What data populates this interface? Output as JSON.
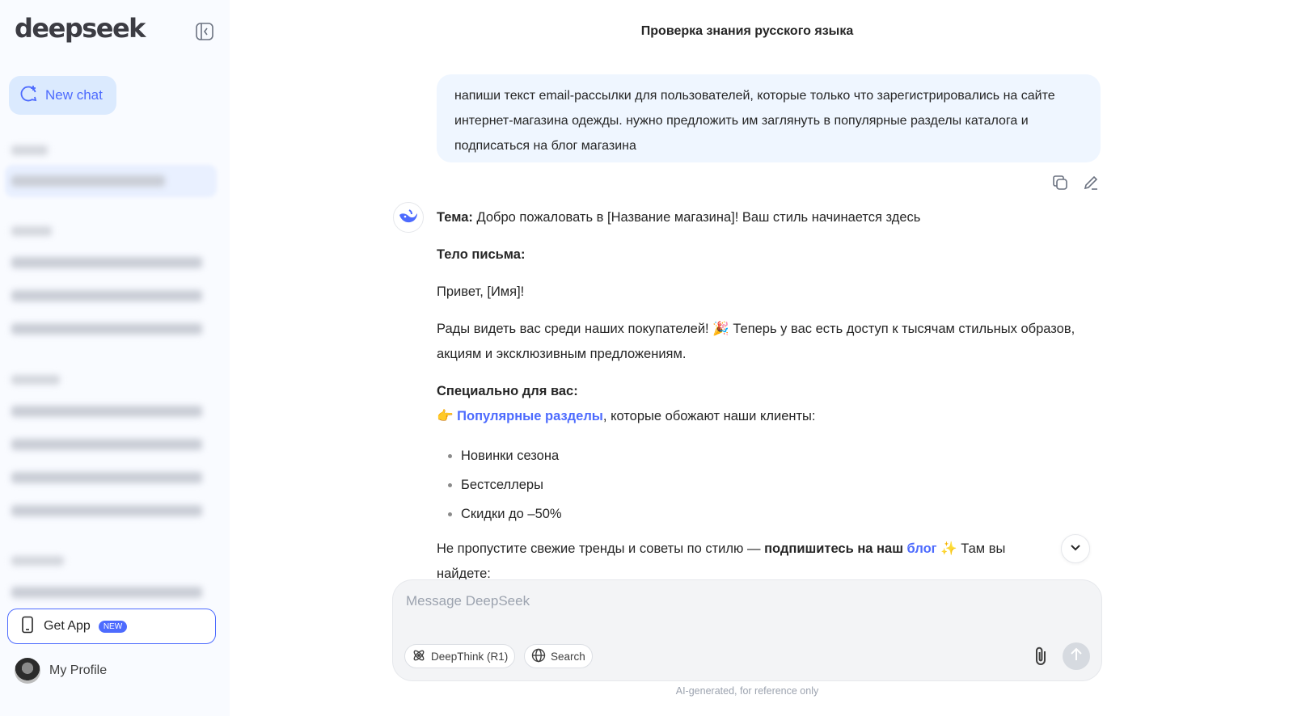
{
  "app": {
    "logo": "deepseek"
  },
  "sidebar": {
    "new_chat_label": "New chat",
    "get_app_label": "Get App",
    "get_app_badge": "NEW",
    "profile_label": "My Profile"
  },
  "chat": {
    "title": "Проверка знания русского языка",
    "user_message": "напиши текст email-рассылки для пользователей, которые только что зарегистрировались на сайте интернет-магазина одежды. нужно предложить им заглянуть в популярные разделы каталога и подписаться на блог магазина",
    "answer": {
      "topic_label": "Тема:",
      "topic_text": " Добро пожаловать в [Название магазина]! Ваш стиль начинается здесь",
      "body_label": "Тело письма:",
      "greeting": "Привет, [Имя]!",
      "glad_text_1": "Рады видеть вас среди наших покупателей! ",
      "glad_emoji": "🎉",
      "glad_text_2": " Теперь у вас есть доступ к тысячам стильных образов, акциям и эксклюзивным предложениям.",
      "special_label": "Специально для вас:",
      "special_emoji": "👉",
      "special_link": "Популярные разделы",
      "special_text": ", которые обожают наши клиенты:",
      "bullets": [
        "Новинки сезона",
        "Бестселлеры",
        "Скидки до –50%"
      ],
      "tail_text_1": "Не пропустите свежие тренды и советы по стилю — ",
      "tail_bold": "подпишитесь на наш ",
      "tail_link": "блог",
      "tail_emoji": " ✨",
      "tail_text_2": " Там вы найдете:"
    }
  },
  "composer": {
    "placeholder": "Message DeepSeek",
    "deepthink_label": "DeepThink (R1)",
    "search_label": "Search",
    "disclaimer": "AI-generated, for reference only"
  },
  "colors": {
    "accent": "#4d6bfe",
    "user_bubble": "#eff6ff",
    "sidebar_bg": "#f9fbff"
  },
  "icons": [
    "collapse-sidebar-icon",
    "new-chat-icon",
    "phone-icon",
    "copy-icon",
    "edit-icon",
    "whale-icon",
    "chevron-down-icon",
    "atom-icon",
    "globe-icon",
    "paperclip-icon",
    "arrow-up-icon"
  ]
}
